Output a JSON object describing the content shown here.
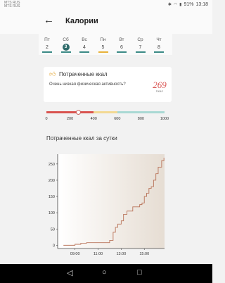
{
  "status_bar": {
    "carrier_line1": "MTS RUS",
    "carrier_line2": "MTS RUS",
    "battery": "91%",
    "time": "13:18"
  },
  "app_bar": {
    "title": "Калории"
  },
  "days": [
    {
      "name": "Пт",
      "num": "2",
      "bar_color": "#3b8a86",
      "active": false
    },
    {
      "name": "Сб",
      "num": "3",
      "bar_color": "#3b8a86",
      "active": true
    },
    {
      "name": "Вс",
      "num": "4",
      "bar_color": "#3b8a86",
      "active": false
    },
    {
      "name": "Пн",
      "num": "5",
      "bar_color": "#e8b23a",
      "active": false
    },
    {
      "name": "Вт",
      "num": "6",
      "bar_color": "#3b8a86",
      "active": false
    },
    {
      "name": "Ср",
      "num": "7",
      "bar_color": "#3b8a86",
      "active": false
    },
    {
      "name": "Чт",
      "num": "8",
      "bar_color": "#3b8a86",
      "active": false
    }
  ],
  "burned_card": {
    "title": "Потраченные ккал",
    "description": "Очень низкая физическая активность?",
    "value": "269",
    "unit": "Ккал",
    "icon": "thumbs-up-icon"
  },
  "activity_scale": {
    "ticks": [
      "0",
      "200",
      "400",
      "600",
      "800",
      "1000"
    ],
    "current_value": 269,
    "max_value": 1000,
    "segments": [
      {
        "from": 0,
        "to": 400,
        "color": "#d9534f"
      },
      {
        "from": 400,
        "to": 600,
        "color": "#f3d993"
      },
      {
        "from": 600,
        "to": 1000,
        "color": "#a9d9d4"
      }
    ]
  },
  "chart_data": {
    "type": "line",
    "title": "Потраченные ккал за сутки",
    "xlabel": "",
    "ylabel": "",
    "xticks": [
      "09:00",
      "11:00",
      "13:00",
      "15:00"
    ],
    "yticks": [
      "0",
      "50",
      "100",
      "150",
      "200",
      "250"
    ],
    "ylim": [
      -10,
      280
    ],
    "x_hours": [
      8.0,
      8.6,
      9.0,
      9.5,
      10.0,
      11.0,
      11.8,
      12.0,
      12.3,
      12.5,
      12.7,
      13.0,
      13.2,
      13.5,
      13.8,
      14.0,
      14.3,
      14.6,
      14.8,
      15.0,
      15.2,
      15.4,
      15.6,
      15.8,
      16.0,
      16.2,
      16.5,
      16.7
    ],
    "values": [
      0,
      0,
      3,
      6,
      8,
      8,
      8,
      15,
      40,
      55,
      65,
      75,
      95,
      105,
      105,
      118,
      118,
      125,
      130,
      150,
      160,
      175,
      180,
      200,
      220,
      240,
      260,
      269
    ],
    "line_color": "#b9745a",
    "grid": false
  },
  "nav_bar": {
    "back_icon": "triangle-back-icon",
    "home_icon": "circle-home-icon",
    "recent_icon": "square-recent-icon"
  }
}
